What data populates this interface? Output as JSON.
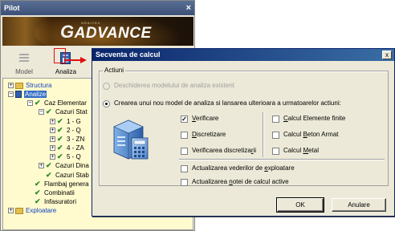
{
  "pilot": {
    "title": "Pilot",
    "close_glyph": "×",
    "logo_small": "GRAITEC",
    "logo_g": "G",
    "logo_text": "ADVANCE",
    "modes": [
      {
        "label": "Model",
        "icon": "layers-icon",
        "active": false
      },
      {
        "label": "Analiza",
        "icon": "calculator-icon",
        "active": true
      }
    ],
    "tree": [
      {
        "label": "Structura",
        "expander": "+",
        "icon": "folder-icon"
      },
      {
        "label": "Analize",
        "expander": "−",
        "icon": "calculator-icon",
        "selected": true
      },
      {
        "label": "Caz Elementar",
        "expander": "−",
        "icon": "check-icon"
      },
      {
        "label": "Cazuri Stat",
        "expander": "−",
        "icon": "check-icon"
      },
      {
        "label": "1 - G",
        "expander": "+",
        "icon": "check-icon"
      },
      {
        "label": "2 - Q",
        "expander": "+",
        "icon": "check-icon"
      },
      {
        "label": "3 - ZN",
        "expander": "+",
        "icon": "check-icon"
      },
      {
        "label": "4 - ZA",
        "expander": "+",
        "icon": "check-icon"
      },
      {
        "label": "5 - Q",
        "expander": "+",
        "icon": "check-icon"
      },
      {
        "label": "Cazuri Dina",
        "expander": "+",
        "icon": "check-icon"
      },
      {
        "label": "Cazuri Stab",
        "expander": "",
        "icon": "check-icon"
      },
      {
        "label": "Flambaj genera",
        "expander": "",
        "icon": "check-icon"
      },
      {
        "label": "Combinatii",
        "expander": "",
        "icon": "check-icon"
      },
      {
        "label": "Infasuratori",
        "expander": "",
        "icon": "check-icon"
      },
      {
        "label": "Exploatare",
        "expander": "+",
        "icon": "folder-icon"
      }
    ]
  },
  "dialog": {
    "title": "Secventa de calcul",
    "close_glyph": "x",
    "group_label": "Actiuni",
    "radio_open_existing": "Deschiderea modelului de analiza existent",
    "radio_create_new": "Crearea unui nou model de analiza si lansarea ulterioara a urmatoarelor actiuni:",
    "options_left": [
      {
        "pre": "",
        "u": "V",
        "post": "erificare",
        "checked": true
      },
      {
        "pre": "",
        "u": "D",
        "post": "iscretizare",
        "checked": false
      },
      {
        "pre": "Verificarea discretiza",
        "u": "r",
        "post": "ii",
        "checked": false
      }
    ],
    "options_right": [
      {
        "pre": "",
        "u": "C",
        "post": "alcul Elemente finite",
        "checked": false
      },
      {
        "pre": "Calcul ",
        "u": "B",
        "post": "eton Armat",
        "checked": false
      },
      {
        "pre": "Calcul ",
        "u": "M",
        "post": "etal",
        "checked": false
      }
    ],
    "options_bottom": [
      {
        "pre": "Actualizarea vederilor de ",
        "u": "e",
        "post": "xploatare",
        "checked": false
      },
      {
        "pre": "Actualizarea ",
        "u": "n",
        "post": "otei de calcul active",
        "checked": false
      }
    ],
    "ok_label": "OK",
    "cancel_label": "Anulare",
    "check_glyph": "✓"
  },
  "colors": {
    "titlebar_start": "#0a246a",
    "titlebar_end": "#3a6ea5",
    "tree_bg": "#fffbcf",
    "selection": "#316ac5",
    "arrow": "#e01010"
  }
}
